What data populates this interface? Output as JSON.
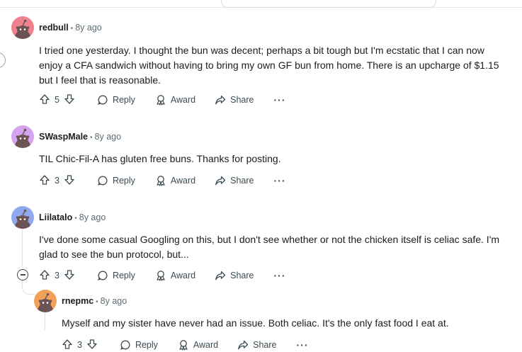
{
  "comments": [
    {
      "user": "redbull",
      "time": "8y ago",
      "avatar_color": "#f0828f",
      "body_lines": [
        "I tried one yesterday. I thought the bun was decent; perhaps a bit tough but I'm ecstatic that I can now",
        "enjoy a CFA sandwich without having to bring my own GF bun from home. There is an upcharge of $1.15",
        "but I feel that is reasonable."
      ],
      "votes": "5",
      "reply": "Reply",
      "award": "Award",
      "share": "Share",
      "more": "···"
    },
    {
      "user": "SWaspMale",
      "time": "8y ago",
      "avatar_color": "#d6a3f0",
      "body_lines": [
        "TIL Chic-Fil-A has gluten free buns. Thanks for posting."
      ],
      "votes": "3",
      "reply": "Reply",
      "award": "Award",
      "share": "Share",
      "more": "···"
    },
    {
      "user": "Liilatalo",
      "time": "8y ago",
      "avatar_color": "#8fa8f0",
      "body_lines": [
        "I've done some casual Googling on this, but I don't see whether or not the chicken itself is celiac safe. I'm",
        "glad to see the bun protocol, but..."
      ],
      "votes": "3",
      "reply": "Reply",
      "award": "Award",
      "share": "Share",
      "more": "···"
    },
    {
      "user": "rnepmc",
      "time": "8y ago",
      "avatar_color": "#f2a05a",
      "body_lines": [
        "Myself and my sister have never had an issue. Both celiac. It's the only fast food I eat at."
      ],
      "votes": "3",
      "reply": "Reply",
      "award": "Award",
      "share": "Share",
      "more": "···"
    }
  ],
  "separator": "•"
}
